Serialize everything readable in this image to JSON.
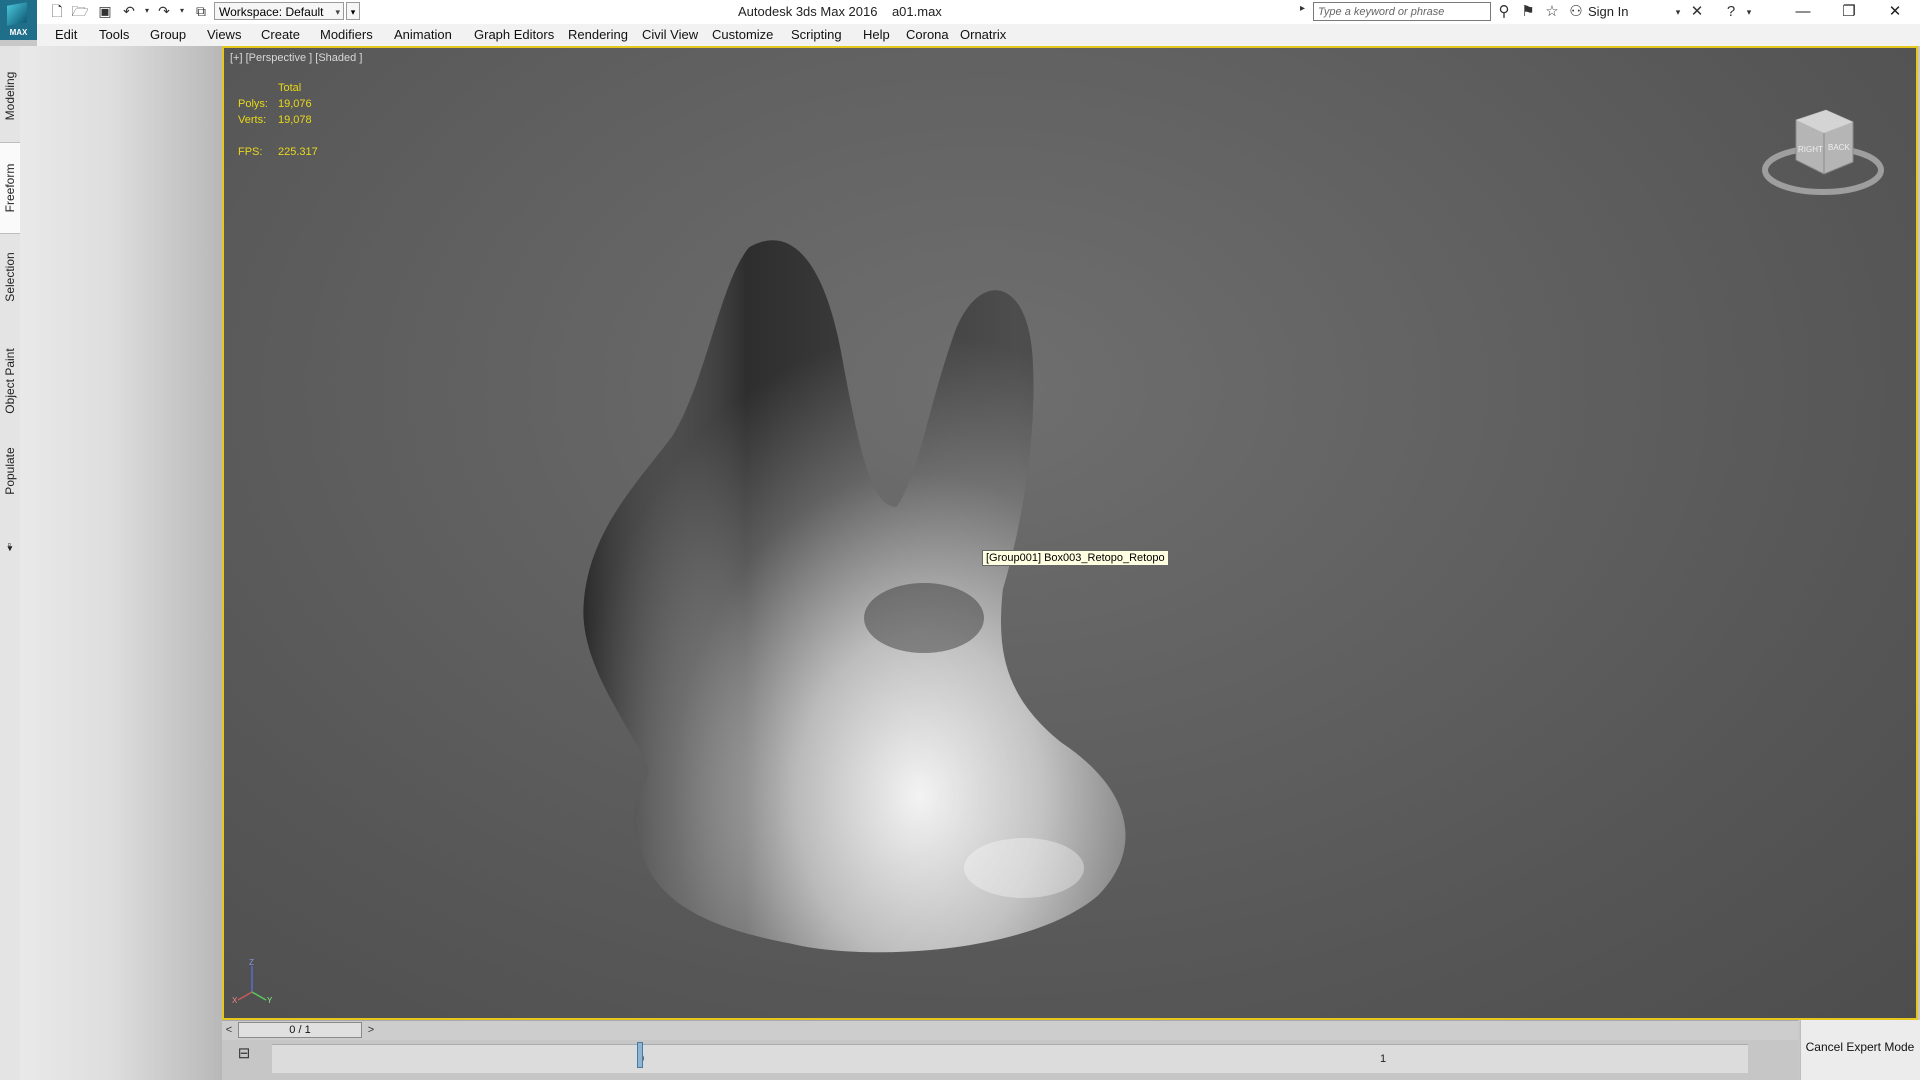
{
  "titlebar": {
    "app_logo_text": "MAX",
    "workspace_label": "Workspace: Default",
    "app_name": "Autodesk 3ds Max 2016",
    "file_name": "a01.max",
    "search_placeholder": "Type a keyword or phrase",
    "sign_in": "Sign In",
    "icons": [
      "new-file-icon",
      "open-file-icon",
      "save-icon",
      "undo-icon",
      "redo-icon",
      "project-folder-icon",
      "binoculars-icon",
      "favorites-icon",
      "star-icon",
      "user-icon",
      "exchange-icon",
      "help-icon",
      "minimize-icon",
      "restore-icon",
      "close-icon"
    ]
  },
  "menubar": {
    "items": [
      "Edit",
      "Tools",
      "Group",
      "Views",
      "Create",
      "Modifiers",
      "Animation",
      "Graph Editors",
      "Rendering",
      "Civil View",
      "Customize",
      "Scripting",
      "Help",
      "Corona",
      "Ornatrix"
    ]
  },
  "ribbon_tabs": [
    "Modeling",
    "Freeform",
    "Selection",
    "Object Paint",
    "Populate"
  ],
  "ribbon_active": "Freeform",
  "viewport": {
    "label": "[+] [Perspective ] [Shaded ]",
    "stats": {
      "header": "Total",
      "polys_label": "Polys:",
      "polys_value": "19,076",
      "verts_label": "Verts:",
      "verts_value": "19,078",
      "fps_label": "FPS:",
      "fps_value": "225.317"
    },
    "tooltip": "[Group001] Box003_Retopo_Retopo",
    "viewcube_faces": [
      "RIGHT",
      "BACK"
    ],
    "axis": [
      "X",
      "Y",
      "Z"
    ],
    "border_color": "#e6c71e"
  },
  "timeline": {
    "prev": "<",
    "slider_text": "0 / 1",
    "next": ">",
    "progress": 0,
    "tick_labels": [
      "0",
      "1"
    ]
  },
  "status": {
    "cancel_expert_mode": "Cancel Expert Mode"
  }
}
